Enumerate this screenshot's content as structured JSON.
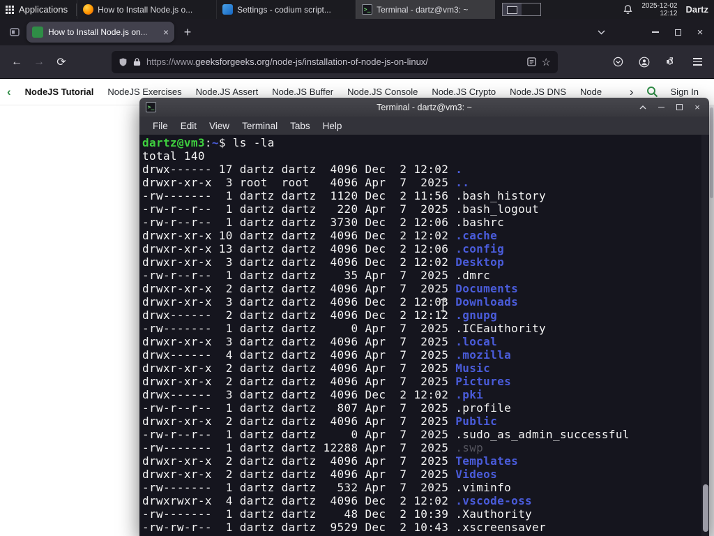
{
  "colors": {
    "term_bg": "#15151e",
    "term_fg": "#f2f2f2",
    "term_green": "#3fcf3f",
    "term_blue": "#4a5cdb",
    "term_dim": "#55555f",
    "gfg_green": "#2f8d46"
  },
  "taskbar": {
    "applications_label": "Applications",
    "windows": [
      {
        "icon": "firefox",
        "title": "How to Install Node.js o...",
        "state": "inactive"
      },
      {
        "icon": "settings",
        "title": "Settings - codium script...",
        "state": "inactive"
      },
      {
        "icon": "terminal",
        "title": "Terminal - dartz@vm3: ~",
        "state": "active"
      }
    ],
    "date": "2025-12-02",
    "time": "12:12",
    "user": "Dartz"
  },
  "browser": {
    "tab_title": "How to Install Node.js on...",
    "new_tab_label": "+",
    "url_scheme": "https://www.",
    "url_domain": "geeksforgeeks.org",
    "url_path": "/node-js/installation-of-node-js-on-linux/"
  },
  "site_nav": {
    "items": [
      {
        "label": "NodeJS Tutorial",
        "state": "current"
      },
      {
        "label": "NodeJS Exercises",
        "state": "normal"
      },
      {
        "label": "Node.JS Assert",
        "state": "normal"
      },
      {
        "label": "Node.JS Buffer",
        "state": "normal"
      },
      {
        "label": "Node.JS Console",
        "state": "normal"
      },
      {
        "label": "Node.JS Crypto",
        "state": "normal"
      },
      {
        "label": "Node.JS DNS",
        "state": "normal"
      },
      {
        "label": "Node",
        "state": "normal"
      }
    ],
    "sign_in": "Sign In"
  },
  "terminal": {
    "title": "Terminal - dartz@vm3: ~",
    "menu": [
      "File",
      "Edit",
      "View",
      "Terminal",
      "Tabs",
      "Help"
    ],
    "prompt_user": "dartz@vm3",
    "prompt_sep": ":",
    "prompt_path": "~",
    "prompt_suffix": "$ ",
    "command": "ls -la",
    "total_line": "total 140",
    "listing": [
      {
        "meta": "drwx------ 17 dartz dartz  4096 Dec  2 12:02 ",
        "name": ".",
        "type": "dir"
      },
      {
        "meta": "drwxr-xr-x  3 root  root   4096 Apr  7  2025 ",
        "name": "..",
        "type": "dir"
      },
      {
        "meta": "-rw-------  1 dartz dartz  1120 Dec  2 11:56 ",
        "name": ".bash_history",
        "type": "file"
      },
      {
        "meta": "-rw-r--r--  1 dartz dartz   220 Apr  7  2025 ",
        "name": ".bash_logout",
        "type": "file"
      },
      {
        "meta": "-rw-r--r--  1 dartz dartz  3730 Dec  2 12:06 ",
        "name": ".bashrc",
        "type": "file"
      },
      {
        "meta": "drwxr-xr-x 10 dartz dartz  4096 Dec  2 12:02 ",
        "name": ".cache",
        "type": "dir"
      },
      {
        "meta": "drwxr-xr-x 13 dartz dartz  4096 Dec  2 12:06 ",
        "name": ".config",
        "type": "dir"
      },
      {
        "meta": "drwxr-xr-x  3 dartz dartz  4096 Dec  2 12:02 ",
        "name": "Desktop",
        "type": "dir"
      },
      {
        "meta": "-rw-r--r--  1 dartz dartz    35 Apr  7  2025 ",
        "name": ".dmrc",
        "type": "file"
      },
      {
        "meta": "drwxr-xr-x  2 dartz dartz  4096 Apr  7  2025 ",
        "name": "Documents",
        "type": "dir"
      },
      {
        "meta": "drwxr-xr-x  3 dartz dartz  4096 Dec  2 12:03 ",
        "name": "Downloads",
        "type": "dir"
      },
      {
        "meta": "drwx------  2 dartz dartz  4096 Dec  2 12:12 ",
        "name": ".gnupg",
        "type": "dir"
      },
      {
        "meta": "-rw-------  1 dartz dartz     0 Apr  7  2025 ",
        "name": ".ICEauthority",
        "type": "file"
      },
      {
        "meta": "drwxr-xr-x  3 dartz dartz  4096 Apr  7  2025 ",
        "name": ".local",
        "type": "dir"
      },
      {
        "meta": "drwx------  4 dartz dartz  4096 Apr  7  2025 ",
        "name": ".mozilla",
        "type": "dir"
      },
      {
        "meta": "drwxr-xr-x  2 dartz dartz  4096 Apr  7  2025 ",
        "name": "Music",
        "type": "dir"
      },
      {
        "meta": "drwxr-xr-x  2 dartz dartz  4096 Apr  7  2025 ",
        "name": "Pictures",
        "type": "dir"
      },
      {
        "meta": "drwx------  3 dartz dartz  4096 Dec  2 12:02 ",
        "name": ".pki",
        "type": "dir"
      },
      {
        "meta": "-rw-r--r--  1 dartz dartz   807 Apr  7  2025 ",
        "name": ".profile",
        "type": "file"
      },
      {
        "meta": "drwxr-xr-x  2 dartz dartz  4096 Apr  7  2025 ",
        "name": "Public",
        "type": "dir"
      },
      {
        "meta": "-rw-r--r--  1 dartz dartz     0 Apr  7  2025 ",
        "name": ".sudo_as_admin_successful",
        "type": "file"
      },
      {
        "meta": "-rw-------  1 dartz dartz 12288 Apr  7  2025 ",
        "name": ".swp",
        "type": "dim"
      },
      {
        "meta": "drwxr-xr-x  2 dartz dartz  4096 Apr  7  2025 ",
        "name": "Templates",
        "type": "dir"
      },
      {
        "meta": "drwxr-xr-x  2 dartz dartz  4096 Apr  7  2025 ",
        "name": "Videos",
        "type": "dir"
      },
      {
        "meta": "-rw-------  1 dartz dartz   532 Apr  7  2025 ",
        "name": ".viminfo",
        "type": "file"
      },
      {
        "meta": "drwxrwxr-x  4 dartz dartz  4096 Dec  2 12:02 ",
        "name": ".vscode-oss",
        "type": "dir"
      },
      {
        "meta": "-rw-------  1 dartz dartz    48 Dec  2 10:39 ",
        "name": ".Xauthority",
        "type": "file"
      },
      {
        "meta": "-rw-rw-r--  1 dartz dartz  9529 Dec  2 10:43 ",
        "name": ".xscreensaver",
        "type": "file"
      }
    ]
  }
}
